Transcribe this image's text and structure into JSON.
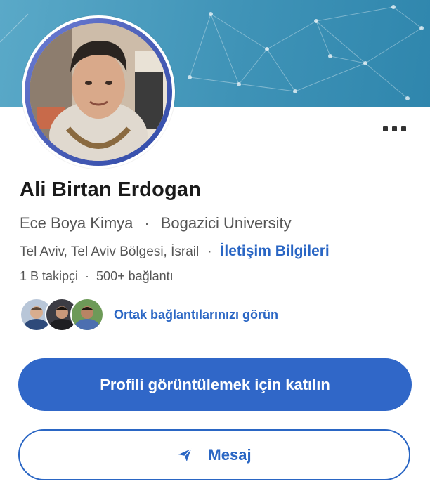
{
  "profile": {
    "name": "Ali Birtan Erdogan",
    "company": "Ece Boya Kimya",
    "school": "Bogazici University",
    "location": "Tel Aviv, Tel Aviv Bölgesi, İsrail",
    "contact_info": "İletişim Bilgileri",
    "followers": "1 B takipçi",
    "connections": "500+ bağlantı",
    "separator": "·"
  },
  "mutual": {
    "link_text": "Ortak bağlantılarınızı görün"
  },
  "actions": {
    "join_label": "Profili görüntülemek için katılın",
    "message_label": "Mesaj"
  },
  "colors": {
    "accent": "#3067c8",
    "link": "#2a66c4",
    "banner": "#3f93b7"
  },
  "icons": {
    "more": "more-horizontal-icon",
    "message": "send-icon"
  }
}
